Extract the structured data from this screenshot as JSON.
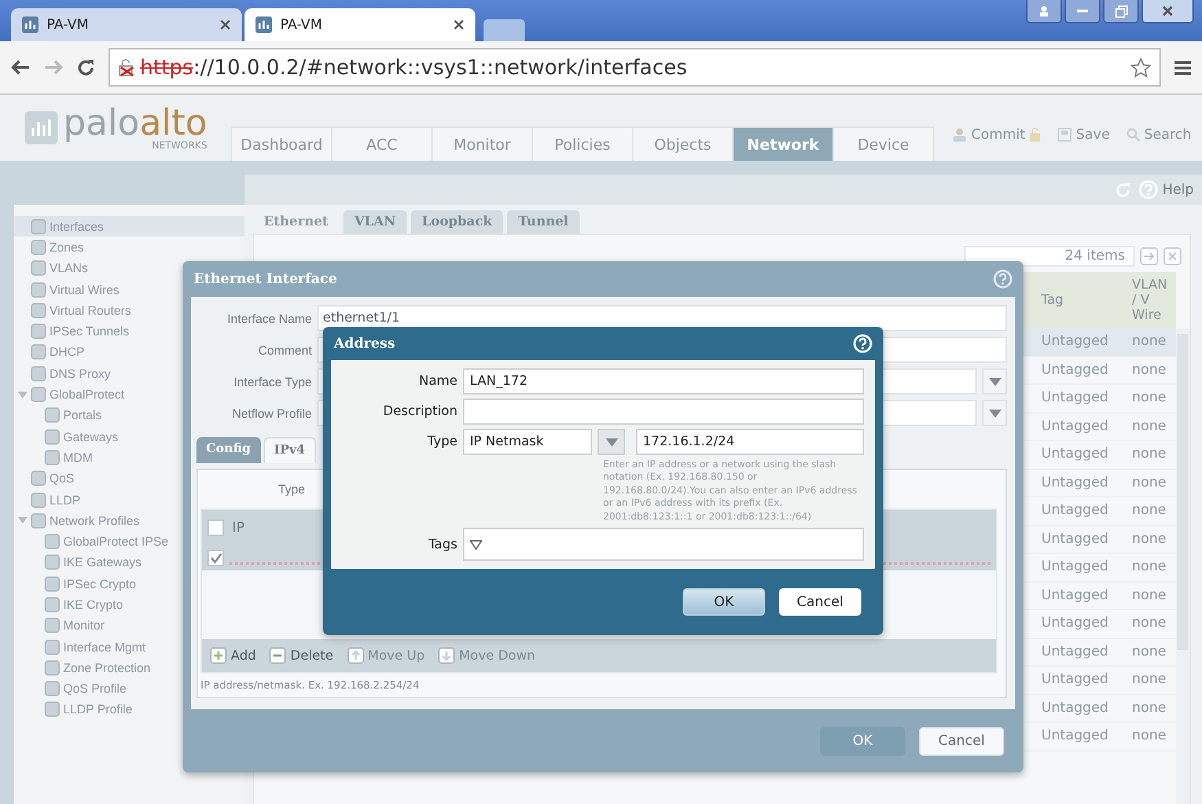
{
  "browser": {
    "tabs": [
      {
        "title": "PA-VM",
        "selected": false
      },
      {
        "title": "PA-VM",
        "selected": true
      }
    ],
    "address": {
      "scheme": "https",
      "rest": "://10.0.0.2/#network::vsys1::network/interfaces"
    }
  },
  "header": {
    "logo": {
      "brand_a": "palo",
      "brand_b": "alto",
      "sub": "NETWORKS"
    },
    "nav": [
      {
        "label": "Dashboard",
        "selected": false
      },
      {
        "label": "ACC",
        "selected": false
      },
      {
        "label": "Monitor",
        "selected": false
      },
      {
        "label": "Policies",
        "selected": false
      },
      {
        "label": "Objects",
        "selected": false
      },
      {
        "label": "Network",
        "selected": true
      },
      {
        "label": "Device",
        "selected": false
      }
    ],
    "actions": [
      {
        "kind": "commit",
        "label": "Commit"
      },
      {
        "kind": "save",
        "label": "Save"
      },
      {
        "kind": "search",
        "label": "Search"
      }
    ]
  },
  "subbar": {
    "help": "Help"
  },
  "sidebar": {
    "items": [
      {
        "label": "Interfaces",
        "selected": true
      },
      {
        "label": "Zones",
        "selected": false
      },
      {
        "label": "VLANs",
        "selected": false
      },
      {
        "label": "Virtual Wires",
        "selected": false
      },
      {
        "label": "Virtual Routers",
        "selected": false
      },
      {
        "label": "IPSec Tunnels",
        "selected": false
      },
      {
        "label": "DHCP",
        "selected": false
      },
      {
        "label": "DNS Proxy",
        "selected": false
      },
      {
        "label": "GlobalProtect",
        "selected": false,
        "expanded": true,
        "children": [
          {
            "label": "Portals",
            "selected": false
          },
          {
            "label": "Gateways",
            "selected": false
          },
          {
            "label": "MDM",
            "selected": false
          }
        ]
      },
      {
        "label": "QoS",
        "selected": false
      },
      {
        "label": "LLDP",
        "selected": false
      },
      {
        "label": "Network Profiles",
        "selected": false,
        "expanded": true,
        "children": [
          {
            "label": "GlobalProtect IPSe",
            "selected": false
          },
          {
            "label": "IKE Gateways",
            "selected": false
          },
          {
            "label": "IPSec Crypto",
            "selected": false
          },
          {
            "label": "IKE Crypto",
            "selected": false
          },
          {
            "label": "Monitor",
            "selected": false
          },
          {
            "label": "Interface Mgmt",
            "selected": false
          },
          {
            "label": "Zone Protection",
            "selected": false
          },
          {
            "label": "QoS Profile",
            "selected": false
          },
          {
            "label": "LLDP Profile",
            "selected": false
          }
        ]
      }
    ]
  },
  "content": {
    "tabs": [
      {
        "label": "Ethernet",
        "selected": true
      },
      {
        "label": "VLAN",
        "selected": false
      },
      {
        "label": "Loopback",
        "selected": false
      },
      {
        "label": "Tunnel",
        "selected": false
      }
    ],
    "item_count": "24 items",
    "table": {
      "columns": [
        "Tag",
        "VLAN / V Wire"
      ],
      "rows": [
        {
          "tag": "Untagged",
          "vlan": "none",
          "selected": true
        },
        {
          "tag": "Untagged",
          "vlan": "none",
          "selected": false
        },
        {
          "tag": "Untagged",
          "vlan": "none",
          "selected": false
        },
        {
          "tag": "Untagged",
          "vlan": "none",
          "selected": false
        },
        {
          "tag": "Untagged",
          "vlan": "none",
          "selected": false
        },
        {
          "tag": "Untagged",
          "vlan": "none",
          "selected": false
        },
        {
          "tag": "Untagged",
          "vlan": "none",
          "selected": false
        },
        {
          "tag": "Untagged",
          "vlan": "none",
          "selected": false
        },
        {
          "tag": "Untagged",
          "vlan": "none",
          "selected": false
        },
        {
          "tag": "Untagged",
          "vlan": "none",
          "selected": false
        },
        {
          "tag": "Untagged",
          "vlan": "none",
          "selected": false
        },
        {
          "tag": "Untagged",
          "vlan": "none",
          "selected": false
        },
        {
          "tag": "Untagged",
          "vlan": "none",
          "selected": false
        },
        {
          "tag": "Untagged",
          "vlan": "none",
          "selected": false
        },
        {
          "tag": "Untagged",
          "vlan": "none",
          "selected": false
        }
      ]
    }
  },
  "ethernet_dialog": {
    "title": "Ethernet Interface",
    "fields": [
      {
        "label": "Interface Name",
        "kind": "text",
        "value": "ethernet1/1"
      },
      {
        "label": "Comment",
        "kind": "text"
      },
      {
        "label": "Interface Type",
        "kind": "select"
      },
      {
        "label": "Netflow Profile",
        "kind": "select"
      }
    ],
    "tabs": [
      {
        "label": "Config",
        "selected": false
      },
      {
        "label": "IPv4",
        "selected": true
      }
    ],
    "type_label": "Type",
    "ip_table": {
      "header": "IP",
      "header_checked": false,
      "rows": [
        {
          "checked": true,
          "invalid": true
        }
      ]
    },
    "toolbar": [
      {
        "kind": "add",
        "label": "Add",
        "disabled": false
      },
      {
        "kind": "delete",
        "label": "Delete",
        "disabled": false
      },
      {
        "kind": "up",
        "label": "Move Up",
        "disabled": true
      },
      {
        "kind": "down",
        "label": "Move Down",
        "disabled": true
      }
    ],
    "hint": "IP address/netmask. Ex. 192.168.2.254/24",
    "buttons": [
      {
        "label": "OK",
        "disabled": true
      },
      {
        "label": "Cancel",
        "disabled": false
      }
    ]
  },
  "address_dialog": {
    "title": "Address",
    "fields": [
      {
        "label": "Name",
        "kind": "text",
        "value": "LAN_172"
      },
      {
        "label": "Description",
        "kind": "text"
      },
      {
        "label": "Type",
        "kind": "typed",
        "select": "IP Netmask",
        "value": "172.16.1.2/24",
        "help": "Enter an IP address or a network using the slash notation (Ex. 192.168.80.150 or 192.168.80.0/24).You can also enter an IPv6 address or an IPv6 address with its prefix (Ex. 2001:db8:123:1::1 or 2001:db8:123:1::/64)"
      },
      {
        "label": "Tags",
        "kind": "tags"
      }
    ],
    "buttons": [
      {
        "label": "OK",
        "primary": true
      },
      {
        "label": "Cancel",
        "primary": false
      }
    ]
  }
}
